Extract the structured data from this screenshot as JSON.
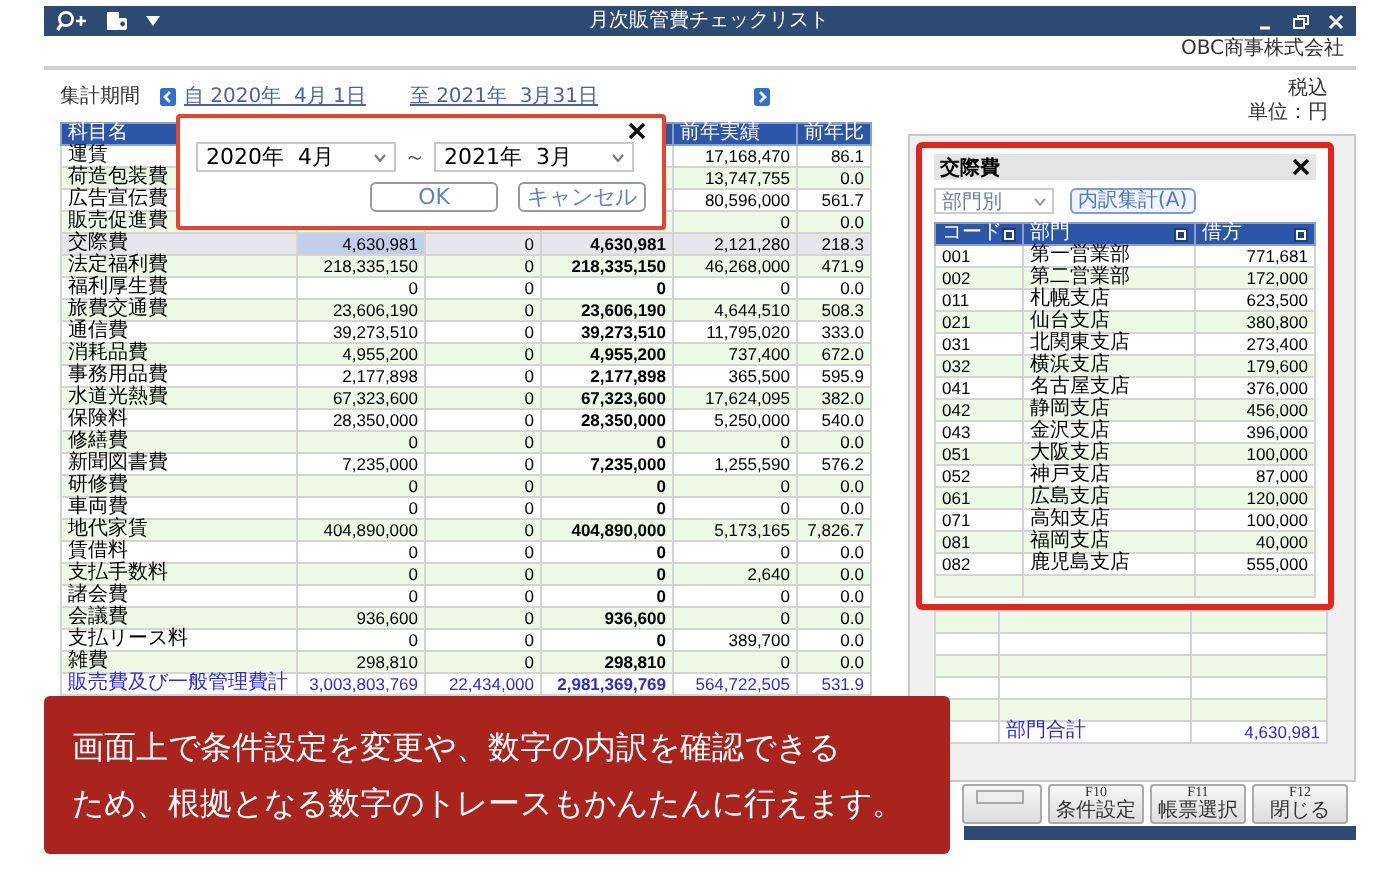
{
  "window": {
    "title": "月次販管費チェックリスト",
    "company": "OBC商事株式会社"
  },
  "period": {
    "label": "集計期間",
    "from": "自 2020年  4月 1日",
    "to": "至 2021年  3月31日"
  },
  "tax_mode": "税込",
  "unit": "単位：円",
  "ledger": {
    "headers": {
      "column_1": "科目名",
      "column_5": "前年実績",
      "column_6": "前年比"
    },
    "rows": [
      {
        "kind": "account",
        "selected": false,
        "account": "運賃",
        "prior_year": "17,168,470",
        "ratio": "86.1"
      },
      {
        "kind": "account",
        "selected": false,
        "account": "荷造包装費",
        "prior_year": "13,747,755",
        "ratio": "0.0"
      },
      {
        "kind": "account",
        "selected": false,
        "account": "広告宣伝費",
        "prior_year": "80,596,000",
        "ratio": "561.7"
      },
      {
        "kind": "account",
        "selected": false,
        "account": "販売促進費",
        "prior_year": "0",
        "ratio": "0.0"
      },
      {
        "kind": "account",
        "selected": true,
        "account": "交際費",
        "column_2": "4,630,981",
        "column_3": "0",
        "column_4": "4,630,981",
        "prior_year": "2,121,280",
        "ratio": "218.3"
      },
      {
        "kind": "account",
        "selected": false,
        "account": "法定福利費",
        "column_2": "218,335,150",
        "column_3": "0",
        "column_4": "218,335,150",
        "prior_year": "46,268,000",
        "ratio": "471.9"
      },
      {
        "kind": "account",
        "selected": false,
        "account": "福利厚生費",
        "column_2": "0",
        "column_3": "0",
        "column_4": "0",
        "prior_year": "0",
        "ratio": "0.0"
      },
      {
        "kind": "account",
        "selected": false,
        "account": "旅費交通費",
        "column_2": "23,606,190",
        "column_3": "0",
        "column_4": "23,606,190",
        "prior_year": "4,644,510",
        "ratio": "508.3"
      },
      {
        "kind": "account",
        "selected": false,
        "account": "通信費",
        "column_2": "39,273,510",
        "column_3": "0",
        "column_4": "39,273,510",
        "prior_year": "11,795,020",
        "ratio": "333.0"
      },
      {
        "kind": "account",
        "selected": false,
        "account": "消耗品費",
        "column_2": "4,955,200",
        "column_3": "0",
        "column_4": "4,955,200",
        "prior_year": "737,400",
        "ratio": "672.0"
      },
      {
        "kind": "account",
        "selected": false,
        "account": "事務用品費",
        "column_2": "2,177,898",
        "column_3": "0",
        "column_4": "2,177,898",
        "prior_year": "365,500",
        "ratio": "595.9"
      },
      {
        "kind": "account",
        "selected": false,
        "account": "水道光熱費",
        "column_2": "67,323,600",
        "column_3": "0",
        "column_4": "67,323,600",
        "prior_year": "17,624,095",
        "ratio": "382.0"
      },
      {
        "kind": "account",
        "selected": false,
        "account": "保険料",
        "column_2": "28,350,000",
        "column_3": "0",
        "column_4": "28,350,000",
        "prior_year": "5,250,000",
        "ratio": "540.0"
      },
      {
        "kind": "account",
        "selected": false,
        "account": "修繕費",
        "column_2": "0",
        "column_3": "0",
        "column_4": "0",
        "prior_year": "0",
        "ratio": "0.0"
      },
      {
        "kind": "account",
        "selected": false,
        "account": "新聞図書費",
        "column_2": "7,235,000",
        "column_3": "0",
        "column_4": "7,235,000",
        "prior_year": "1,255,590",
        "ratio": "576.2"
      },
      {
        "kind": "account",
        "selected": false,
        "account": "研修費",
        "column_2": "0",
        "column_3": "0",
        "column_4": "0",
        "prior_year": "0",
        "ratio": "0.0"
      },
      {
        "kind": "account",
        "selected": false,
        "account": "車両費",
        "column_2": "0",
        "column_3": "0",
        "column_4": "0",
        "prior_year": "0",
        "ratio": "0.0"
      },
      {
        "kind": "account",
        "selected": false,
        "account": "地代家賃",
        "column_2": "404,890,000",
        "column_3": "0",
        "column_4": "404,890,000",
        "prior_year": "5,173,165",
        "ratio": "7,826.7"
      },
      {
        "kind": "account",
        "selected": false,
        "account": "賃借料",
        "column_2": "0",
        "column_3": "0",
        "column_4": "0",
        "prior_year": "0",
        "ratio": "0.0"
      },
      {
        "kind": "account",
        "selected": false,
        "account": "支払手数料",
        "column_2": "0",
        "column_3": "0",
        "column_4": "0",
        "prior_year": "2,640",
        "ratio": "0.0"
      },
      {
        "kind": "account",
        "selected": false,
        "account": "諸会費",
        "column_2": "0",
        "column_3": "0",
        "column_4": "0",
        "prior_year": "0",
        "ratio": "0.0"
      },
      {
        "kind": "account",
        "selected": false,
        "account": "会議費",
        "column_2": "936,600",
        "column_3": "0",
        "column_4": "936,600",
        "prior_year": "0",
        "ratio": "0.0"
      },
      {
        "kind": "account",
        "selected": false,
        "account": "支払リース料",
        "column_2": "0",
        "column_3": "0",
        "column_4": "0",
        "prior_year": "389,700",
        "ratio": "0.0"
      },
      {
        "kind": "account",
        "selected": false,
        "account": "雑費",
        "column_2": "298,810",
        "column_3": "0",
        "column_4": "298,810",
        "prior_year": "0",
        "ratio": "0.0"
      },
      {
        "kind": "total",
        "selected": false,
        "account": "販売費及び一般管理費計",
        "column_2": "3,003,803,769",
        "column_3": "22,434,000",
        "column_4": "2,981,369,769",
        "prior_year": "564,722,505",
        "ratio": "531.9"
      }
    ]
  },
  "dialog": {
    "from": "2020年  4月",
    "separator": "～",
    "to": "2021年  3月",
    "ok": "OK",
    "cancel": "キャンセル"
  },
  "breakdown": {
    "title": "交際費",
    "grouping": "部門別",
    "button": "内訳集計(A)",
    "columns": [
      "コード",
      "部門",
      "借方"
    ],
    "rows": [
      {
        "code": "001",
        "department": "第一営業部",
        "debit": "771,681"
      },
      {
        "code": "002",
        "department": "第二営業部",
        "debit": "172,000"
      },
      {
        "code": "011",
        "department": "札幌支店",
        "debit": "623,500"
      },
      {
        "code": "021",
        "department": "仙台支店",
        "debit": "380,800"
      },
      {
        "code": "031",
        "department": "北関東支店",
        "debit": "273,400"
      },
      {
        "code": "032",
        "department": "横浜支店",
        "debit": "179,600"
      },
      {
        "code": "041",
        "department": "名古屋支店",
        "debit": "376,000"
      },
      {
        "code": "042",
        "department": "静岡支店",
        "debit": "456,000"
      },
      {
        "code": "043",
        "department": "金沢支店",
        "debit": "396,000"
      },
      {
        "code": "051",
        "department": "大阪支店",
        "debit": "100,000"
      },
      {
        "code": "052",
        "department": "神戸支店",
        "debit": "87,000"
      },
      {
        "code": "061",
        "department": "広島支店",
        "debit": "120,000"
      },
      {
        "code": "071",
        "department": "高知支店",
        "debit": "100,000"
      },
      {
        "code": "081",
        "department": "福岡支店",
        "debit": "40,000"
      },
      {
        "code": "082",
        "department": "鹿児島支店",
        "debit": "555,000"
      }
    ],
    "total": {
      "label": "部門合計",
      "debit": "4,630,981"
    }
  },
  "function_keys": [
    {
      "kind": "blank"
    },
    {
      "kind": "key",
      "key": "F10",
      "label": "条件設定"
    },
    {
      "kind": "key",
      "key": "F11",
      "label": "帳票選択"
    },
    {
      "kind": "key",
      "key": "F12",
      "label": "閉じる"
    }
  ],
  "caption": {
    "lines": [
      "画面上で条件設定を変更や、数字の内訳を確認できる",
      "ため、根拠となる数字のトレースもかんたんに行えます。"
    ]
  }
}
